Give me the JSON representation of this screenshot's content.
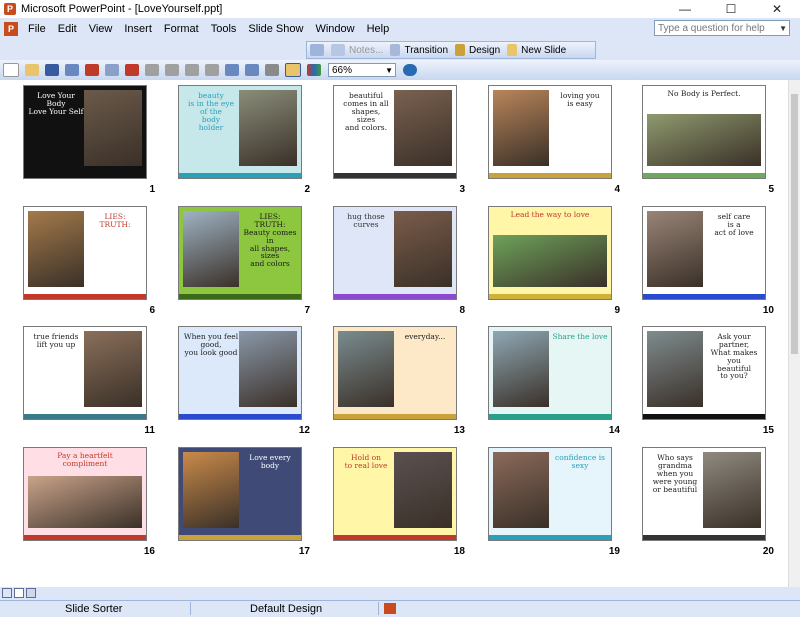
{
  "window": {
    "title": "Microsoft PowerPoint - [LoveYourself.ppt]",
    "app_icon": "P"
  },
  "menu": {
    "items": [
      "File",
      "Edit",
      "View",
      "Insert",
      "Format",
      "Tools",
      "Slide Show",
      "Window",
      "Help"
    ],
    "help_placeholder": "Type a question for help"
  },
  "slide_sorter_toolbar": {
    "notes": "Notes...",
    "transition": "Transition",
    "design": "Design",
    "new_slide": "New Slide"
  },
  "standard_toolbar": {
    "zoom": "66%"
  },
  "slides": [
    {
      "num": "1",
      "bg": "#111111",
      "photo": "#6b5a4a",
      "photo_box": "right",
      "text": "Love Your Body\nLove Your Self",
      "text_color": "#ffffff",
      "foot": "#111111"
    },
    {
      "num": "2",
      "bg": "#c7e8ea",
      "photo": "#8a8d7a",
      "photo_box": "right",
      "text": "beauty\nis in the eye\nof the\nbody\nholder",
      "text_color": "#2aa0b8",
      "foot": "#2aa0b8"
    },
    {
      "num": "3",
      "bg": "#ffffff",
      "photo": "#7a6150",
      "photo_box": "right",
      "text": "beautiful\ncomes in all\nshapes,\nsizes\nand colors.",
      "text_color": "#222222",
      "foot": "#333333"
    },
    {
      "num": "4",
      "bg": "#ffffff",
      "photo": "#b9855a",
      "photo_box": "left",
      "text": "loving you\nis easy",
      "text_color": "#222222",
      "foot": "#c9a23a"
    },
    {
      "num": "5",
      "bg": "#ffffff",
      "photo": "#8f9a6e",
      "photo_box": "bottom",
      "text": "No Body is Perfect.",
      "text_color": "#222222",
      "foot": "#6aaa5a"
    },
    {
      "num": "6",
      "bg": "#ffffff",
      "photo": "#a37a4a",
      "photo_box": "left",
      "text": "LIES:\nTRUTH:",
      "text_color": "#c0392b",
      "foot": "#c0392b"
    },
    {
      "num": "7",
      "bg": "#8dc63f",
      "photo": "#9fb3c4",
      "photo_box": "left",
      "text": "LIES:\nTRUTH:\nBeauty comes in\nall shapes, sizes\nand colors",
      "text_color": "#1a1a1a",
      "foot": "#3a6a1a"
    },
    {
      "num": "8",
      "bg": "#dfe6f7",
      "photo": "#7a5c4a",
      "photo_box": "right",
      "text": "hug those curves",
      "text_color": "#333333",
      "foot": "#8a4ad0"
    },
    {
      "num": "9",
      "bg": "#fff6a8",
      "photo": "#6ea25a",
      "photo_box": "bottom",
      "text": "Lead the way to love",
      "text_color": "#c0392b",
      "foot": "#d0b23a"
    },
    {
      "num": "10",
      "bg": "#ffffff",
      "photo": "#9a8577",
      "photo_box": "left",
      "text": "self care\nis a\nact of love",
      "text_color": "#222222",
      "foot": "#2a4ad0"
    },
    {
      "num": "11",
      "bg": "#ffffff",
      "photo": "#8a6f5a",
      "photo_box": "right",
      "text": "true friends\nlift you up",
      "text_color": "#222222",
      "foot": "#3a7a8a"
    },
    {
      "num": "12",
      "bg": "#dbe9fb",
      "photo": "#8a97a8",
      "photo_box": "right",
      "text": "When you feel good,\nyou look good",
      "text_color": "#222222",
      "foot": "#2a4ad0"
    },
    {
      "num": "13",
      "bg": "#fde9c8",
      "photo": "#7a8c8f",
      "photo_box": "left",
      "text": "everyday...",
      "text_color": "#222222",
      "foot": "#c9a23a"
    },
    {
      "num": "14",
      "bg": "#e6f6f4",
      "photo": "#8fa8b4",
      "photo_box": "left",
      "text": "Share the love",
      "text_color": "#2aa08a",
      "foot": "#2aa08a"
    },
    {
      "num": "15",
      "bg": "#ffffff",
      "photo": "#7f8c8f",
      "photo_box": "left",
      "text": "Ask your\npartner,\nWhat makes you\nbeautiful\nto you?",
      "text_color": "#222222",
      "foot": "#111111"
    },
    {
      "num": "16",
      "bg": "#ffdfe5",
      "photo": "#c9a38a",
      "photo_box": "bottom",
      "text": "Pay a heartfelt\ncompliment",
      "text_color": "#c0392b",
      "foot": "#c0392b"
    },
    {
      "num": "17",
      "bg": "#3f4a77",
      "photo": "#c98a4a",
      "photo_box": "left",
      "text": "Love every body",
      "text_color": "#ffffff",
      "foot": "#c9a23a"
    },
    {
      "num": "18",
      "bg": "#fff6a8",
      "photo": "#5a5050",
      "photo_box": "right",
      "text": "Hold on\nto real love",
      "text_color": "#c0392b",
      "foot": "#c0392b"
    },
    {
      "num": "19",
      "bg": "#e6f4fb",
      "photo": "#8a6a5a",
      "photo_box": "left",
      "text": "confidence is sexy",
      "text_color": "#2aa0b8",
      "foot": "#2aa0b8"
    },
    {
      "num": "20",
      "bg": "#ffffff",
      "photo": "#8f8a80",
      "photo_box": "right",
      "text": "Who says\ngrandma\nwhen you were young\nor beautiful",
      "text_color": "#222222",
      "foot": "#333333"
    }
  ],
  "status": {
    "view": "Slide Sorter",
    "design": "Default Design"
  }
}
